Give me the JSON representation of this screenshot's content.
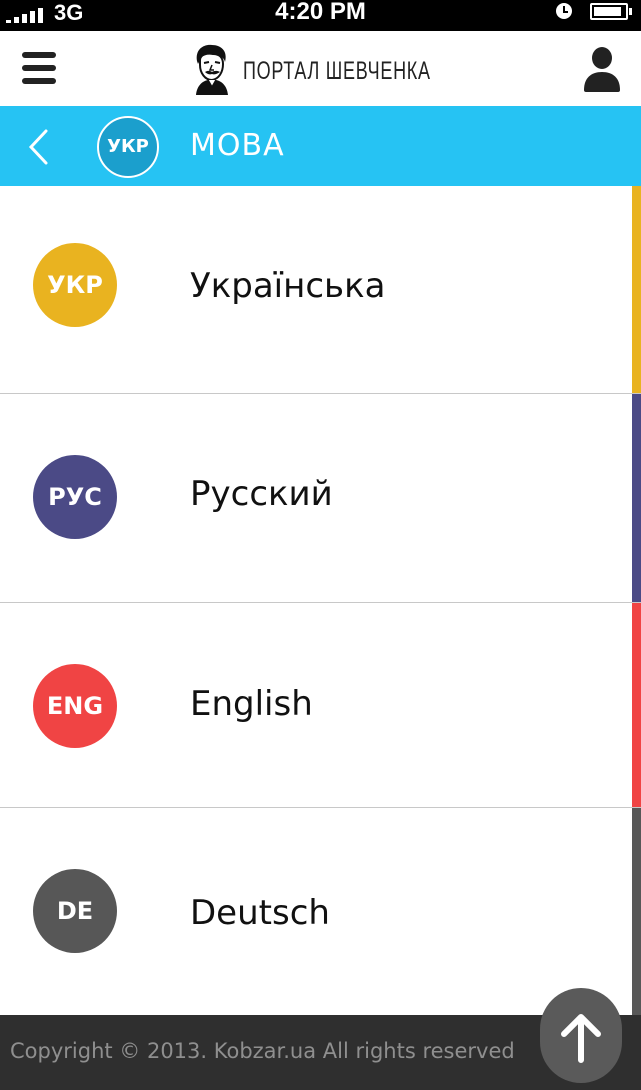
{
  "status_bar": {
    "carrier": "3G",
    "time": "4:20 PM",
    "icons": [
      "signal-icon",
      "alarm-clock-icon",
      "battery-icon"
    ],
    "battery_level": 0.9
  },
  "header": {
    "logo_text": "ПОРТАЛ ШЕВЧЕНКА",
    "icons": [
      "menu-icon",
      "portrait-icon",
      "user-icon"
    ]
  },
  "language_bar": {
    "badge": "УКР",
    "title": "МОВА",
    "color": "#26c3f3",
    "icons": [
      "back-chevron-icon"
    ]
  },
  "languages": [
    {
      "code": "УКР",
      "name": "Українська",
      "color": "#e9b320"
    },
    {
      "code": "РУС",
      "name": "Русский",
      "color": "#4b4a86"
    },
    {
      "code": "ENG",
      "name": "English",
      "color": "#f04444"
    },
    {
      "code": "DE",
      "name": "Deutsch",
      "color": "#575757"
    }
  ],
  "footer": {
    "copyright": "Copyright © 2013. Kobzar.ua  All rights reserved",
    "icons": [
      "arrow-up-icon"
    ]
  }
}
